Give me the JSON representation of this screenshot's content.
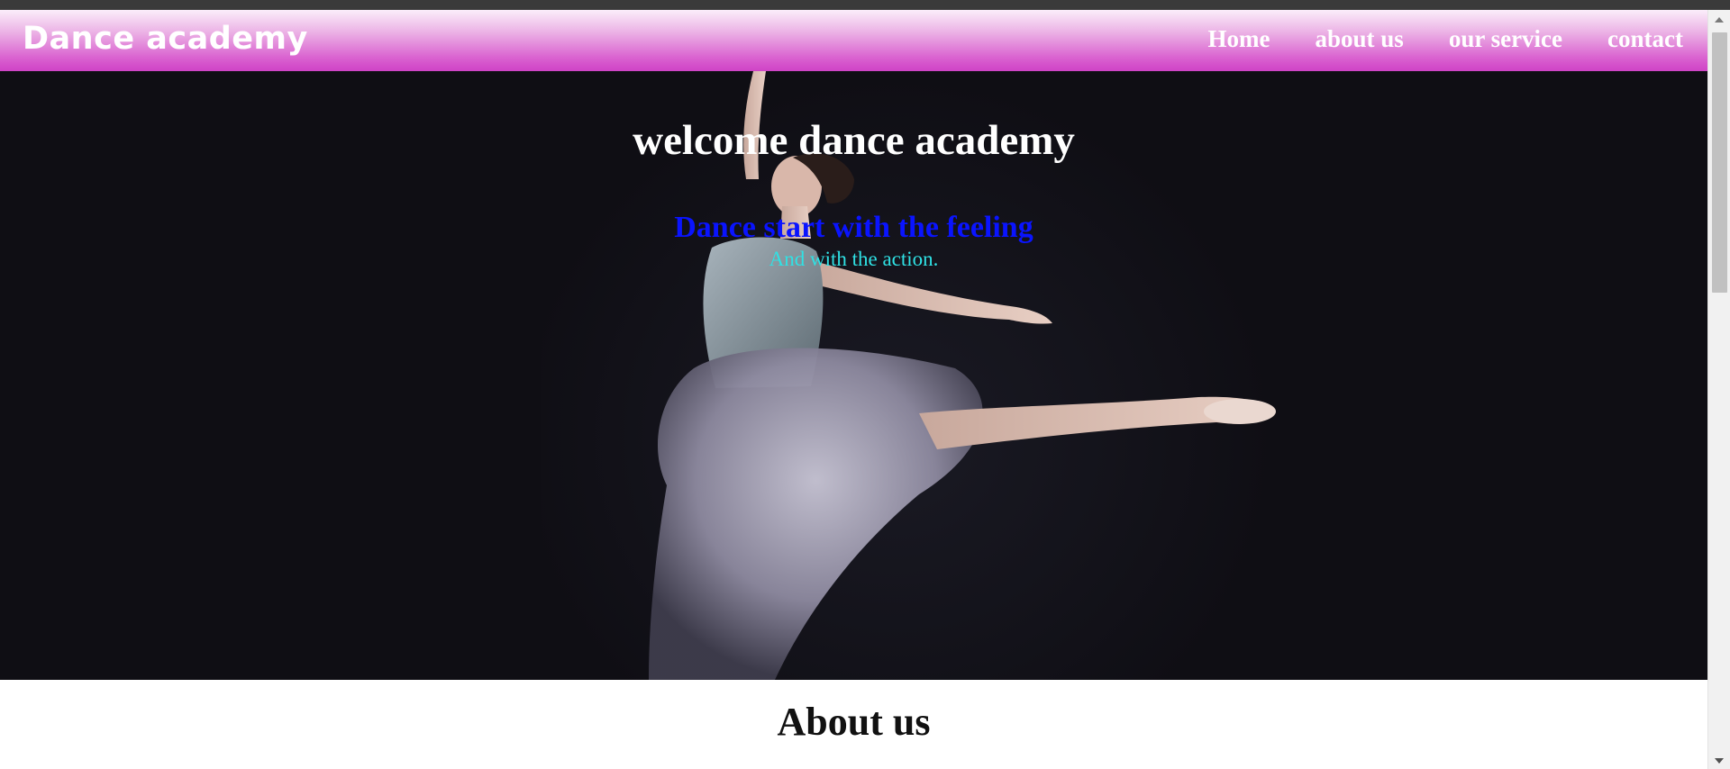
{
  "navbar": {
    "brand": "Dance academy",
    "links": [
      "Home",
      "about us",
      "our service",
      "contact"
    ]
  },
  "hero": {
    "title": "welcome dance academy",
    "subtitle": "Dance start with the feeling",
    "tagline": "And with the action."
  },
  "about": {
    "heading": "About us"
  },
  "colors": {
    "navbar_gradient_top": "#fbeefa",
    "navbar_gradient_bottom": "#cf43c6",
    "hero_background": "#0f0e14",
    "subtitle": "#0a14ff",
    "tagline": "#2fe1e4"
  }
}
